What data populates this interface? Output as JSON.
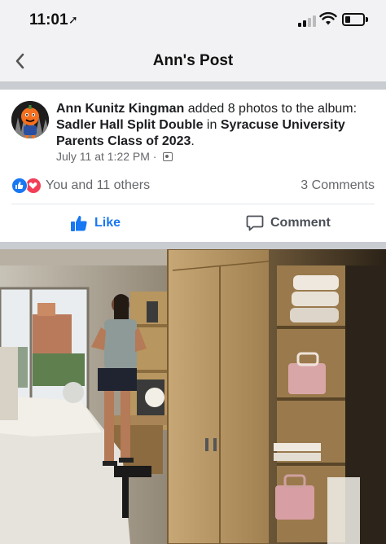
{
  "status_bar": {
    "time": "11:01",
    "location_arrow": "➚",
    "signal_icon": "signal-icon",
    "wifi_icon": "wifi-icon",
    "battery_icon": "battery-icon",
    "battery_level": 0.3
  },
  "nav": {
    "back_icon": "chevron-left-icon",
    "title": "Ann's Post"
  },
  "post": {
    "author": "Ann Kunitz Kingman",
    "action_text": " added 8 photos to the album: ",
    "album_name": "Sadler Hall Split Double",
    "in_text": " in ",
    "group_name": "Syracuse University Parents Class of 2023",
    "end_text": ".",
    "timestamp": "July 11 at 1:22 PM",
    "meta_separator": " · ",
    "privacy_icon": "album-icon"
  },
  "reactions": {
    "text": "You and 11 others",
    "comments": "3 Comments",
    "icons": [
      "like-reaction-icon",
      "love-reaction-icon"
    ],
    "colors": {
      "like": "#1877f2",
      "love": "#f33e58"
    }
  },
  "actions": {
    "like_label": "Like",
    "comment_label": "Comment"
  },
  "colors": {
    "accent": "#1877f2",
    "background": "#f2f2f4",
    "separator": "#c9ccd1"
  }
}
